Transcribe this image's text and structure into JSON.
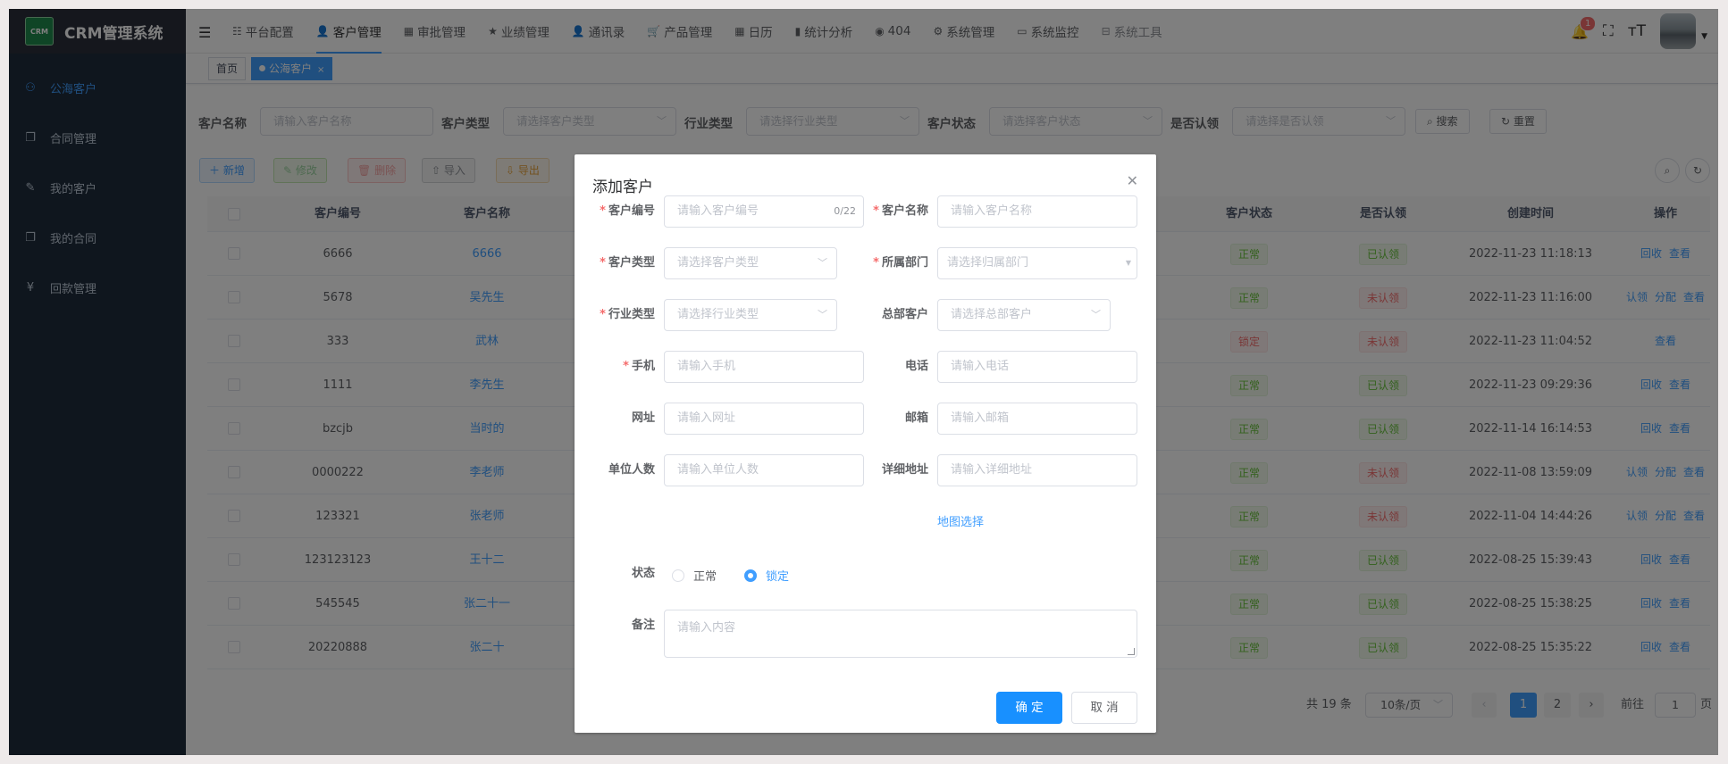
{
  "app": {
    "logo_text": "CRM",
    "title": "CRM管理系统"
  },
  "sidebar": {
    "items": [
      {
        "label": "公海客户",
        "icon": "sitemap-icon",
        "active": true
      },
      {
        "label": "合同管理",
        "icon": "documents-icon"
      },
      {
        "label": "我的客户",
        "icon": "edit-icon"
      },
      {
        "label": "我的合同",
        "icon": "documents-icon"
      },
      {
        "label": "回款管理",
        "icon": "yen-icon"
      }
    ]
  },
  "topnav": {
    "items": [
      {
        "label": "平台配置",
        "icon": "list-icon"
      },
      {
        "label": "客户管理",
        "icon": "user-icon",
        "active": true
      },
      {
        "label": "审批管理",
        "icon": "table-icon"
      },
      {
        "label": "业绩管理",
        "icon": "star-icon"
      },
      {
        "label": "通讯录",
        "icon": "user-icon"
      },
      {
        "label": "产品管理",
        "icon": "cart-icon"
      },
      {
        "label": "日历",
        "icon": "table-icon"
      },
      {
        "label": "统计分析",
        "icon": "bar-chart-icon"
      },
      {
        "label": "404",
        "icon": "404-icon"
      },
      {
        "label": "系统管理",
        "icon": "gear-icon"
      },
      {
        "label": "系统监控",
        "icon": "monitor-icon"
      },
      {
        "label": "系统工具",
        "icon": "toolbox-icon"
      }
    ],
    "notification_count": "1"
  },
  "tags": {
    "home": "首页",
    "current": "公海客户",
    "close": "×"
  },
  "filters": {
    "name_label": "客户名称",
    "name_placeholder": "请输入客户名称",
    "type_label": "客户类型",
    "type_placeholder": "请选择客户类型",
    "industry_label": "行业类型",
    "industry_placeholder": "请选择行业类型",
    "status_label": "客户状态",
    "status_placeholder": "请选择客户状态",
    "claim_label": "是否认领",
    "claim_placeholder": "请选择是否认领",
    "search_btn": "搜索",
    "reset_btn": "重置"
  },
  "actions": {
    "add": "新增",
    "edit": "修改",
    "delete": "删除",
    "import": "导入",
    "export": "导出"
  },
  "table": {
    "headers": {
      "code": "客户编号",
      "name": "客户名称",
      "status": "客户状态",
      "claimed": "是否认领",
      "created": "创建时间",
      "ops": "操作"
    },
    "rows": [
      {
        "code": "6666",
        "name": "6666",
        "status": "正常",
        "claimed": "已认领",
        "created": "2022-11-23 11:18:13",
        "ops": [
          "回收",
          "查看"
        ]
      },
      {
        "code": "5678",
        "name": "吴先生",
        "status": "正常",
        "claimed": "未认领",
        "created": "2022-11-23 11:16:00",
        "ops": [
          "认领",
          "分配",
          "查看"
        ]
      },
      {
        "code": "333",
        "name": "武林",
        "status": "锁定",
        "claimed": "未认领",
        "created": "2022-11-23 11:04:52",
        "ops": [
          "查看"
        ]
      },
      {
        "code": "1111",
        "name": "李先生",
        "status": "正常",
        "claimed": "已认领",
        "created": "2022-11-23 09:29:36",
        "ops": [
          "回收",
          "查看"
        ]
      },
      {
        "code": "bzcjb",
        "name": "当时的",
        "status": "正常",
        "claimed": "已认领",
        "created": "2022-11-14 16:14:53",
        "ops": [
          "回收",
          "查看"
        ]
      },
      {
        "code": "0000222",
        "name": "李老师",
        "status": "正常",
        "claimed": "未认领",
        "created": "2022-11-08 13:59:09",
        "ops": [
          "认领",
          "分配",
          "查看"
        ]
      },
      {
        "code": "123321",
        "name": "张老师",
        "status": "正常",
        "claimed": "未认领",
        "created": "2022-11-04 14:44:26",
        "ops": [
          "认领",
          "分配",
          "查看"
        ]
      },
      {
        "code": "123123123",
        "name": "王十二",
        "status": "正常",
        "claimed": "已认领",
        "created": "2022-08-25 15:39:43",
        "ops": [
          "回收",
          "查看"
        ]
      },
      {
        "code": "545545",
        "name": "张二十一",
        "status": "正常",
        "claimed": "已认领",
        "created": "2022-08-25 15:38:25",
        "ops": [
          "回收",
          "查看"
        ]
      },
      {
        "code": "20220888",
        "name": "张二十",
        "status": "正常",
        "claimed": "已认领",
        "created": "2022-08-25 15:35:22",
        "ops": [
          "回收",
          "查看"
        ]
      }
    ]
  },
  "pagination": {
    "total": "共 19 条",
    "page_size": "10条/页",
    "pages": [
      "1",
      "2"
    ],
    "current": "1",
    "goto_label": "前往",
    "goto_value": "1",
    "page_unit": "页"
  },
  "dialog": {
    "title": "添加客户",
    "fields": {
      "code": {
        "label": "客户编号",
        "placeholder": "请输入客户编号",
        "counter": "0/22"
      },
      "name": {
        "label": "客户名称",
        "placeholder": "请输入客户名称"
      },
      "type": {
        "label": "客户类型",
        "placeholder": "请选择客户类型"
      },
      "dept": {
        "label": "所属部门",
        "placeholder": "请选择归属部门"
      },
      "industry": {
        "label": "行业类型",
        "placeholder": "请选择行业类型"
      },
      "hq": {
        "label": "总部客户",
        "placeholder": "请选择总部客户"
      },
      "mobile": {
        "label": "手机",
        "placeholder": "请输入手机"
      },
      "phone": {
        "label": "电话",
        "placeholder": "请输入电话"
      },
      "website": {
        "label": "网址",
        "placeholder": "请输入网址"
      },
      "email": {
        "label": "邮箱",
        "placeholder": "请输入邮箱"
      },
      "staff": {
        "label": "单位人数",
        "placeholder": "请输入单位人数"
      },
      "address": {
        "label": "详细地址",
        "placeholder": "请输入详细地址"
      },
      "status": {
        "label": "状态",
        "options": [
          "正常",
          "锁定"
        ],
        "selected": "锁定"
      },
      "remark": {
        "label": "备注",
        "placeholder": "请输入内容"
      }
    },
    "map_link": "地图选择",
    "ok": "确 定",
    "cancel": "取 消"
  },
  "colors": {
    "primary": "#409eff",
    "sidebar_bg": "#1f2d3d",
    "success": "#67c23a",
    "danger": "#f56c6c"
  }
}
